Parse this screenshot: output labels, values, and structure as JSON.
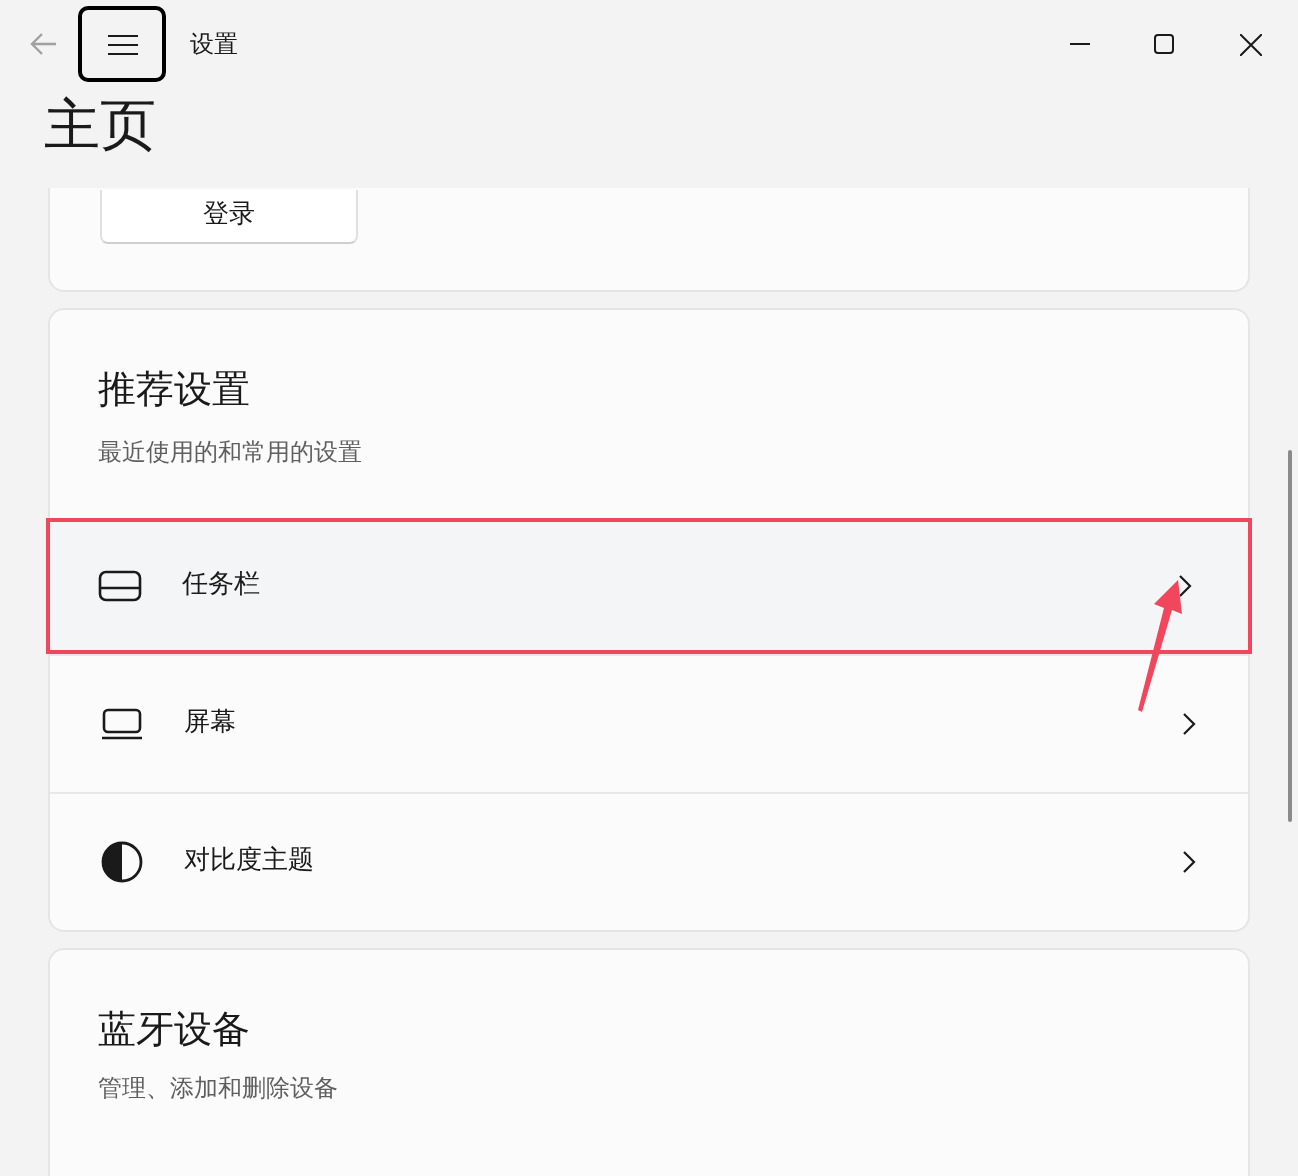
{
  "window": {
    "title": "设置"
  },
  "page_title": "主页",
  "account_card": {
    "login_button": "登录"
  },
  "recommended": {
    "title": "推荐设置",
    "subtitle": "最近使用的和常用的设置",
    "items": [
      {
        "kind": "taskbar",
        "label": "任务栏",
        "highlighted": true
      },
      {
        "kind": "screen",
        "label": "屏幕",
        "highlighted": false
      },
      {
        "kind": "contrast",
        "label": "对比度主题",
        "highlighted": false
      }
    ]
  },
  "bluetooth": {
    "title": "蓝牙设备",
    "subtitle": "管理、添加和删除设备"
  }
}
